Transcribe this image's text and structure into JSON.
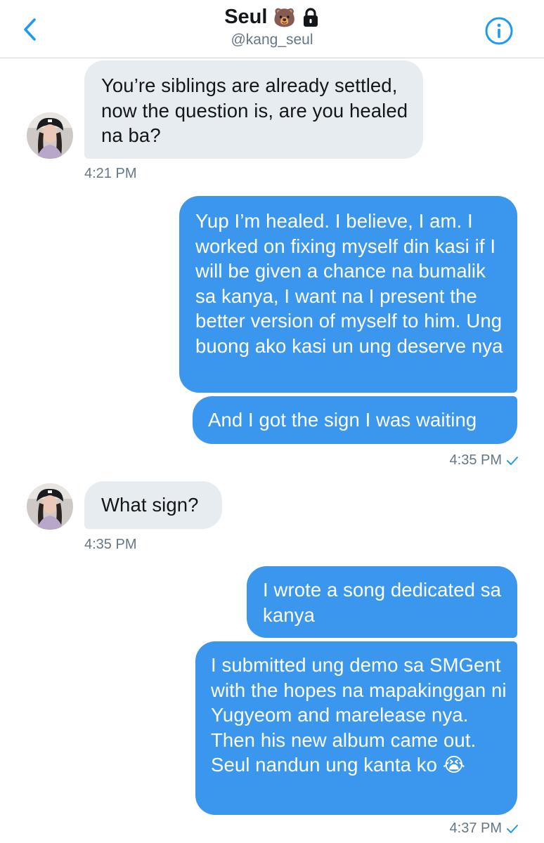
{
  "header": {
    "name": "Seul",
    "name_emoji": "🐻",
    "handle": "@kang_seul",
    "icons": {
      "back": "chevron-left-icon",
      "lock": "lock-icon",
      "info": "info-icon"
    }
  },
  "colors": {
    "accent": "#1d9bf0",
    "incoming_bubble": "#e6ecf0",
    "outgoing_bubble": "#3b97ee",
    "meta_text": "#657786"
  },
  "messages": [
    {
      "from": "them",
      "text": "You’re siblings are already settled, now the question is, are you healed na ba?",
      "time": "4:21 PM"
    },
    {
      "from": "me",
      "text": "Yup I’m healed. I believe, I am. I worked on fixing myself din kasi if I will be given a chance na bumalik sa kanya, I want na I present the better version of myself to him. Ung buong ako kasi un ung deserve nya"
    },
    {
      "from": "me",
      "text": "And I got the sign I was waiting",
      "time": "4:35 PM"
    },
    {
      "from": "them",
      "text": "What sign?",
      "time": "4:35 PM"
    },
    {
      "from": "me",
      "text": "I wrote a song dedicated sa kanya"
    },
    {
      "from": "me",
      "text": "I submitted ung demo sa SMGent with the hopes na mapakinggan ni Yugyeom and marelease nya. Then his new album came out. Seul nandun ung kanta ko",
      "emoji": "😭",
      "time": "4:37 PM"
    }
  ]
}
